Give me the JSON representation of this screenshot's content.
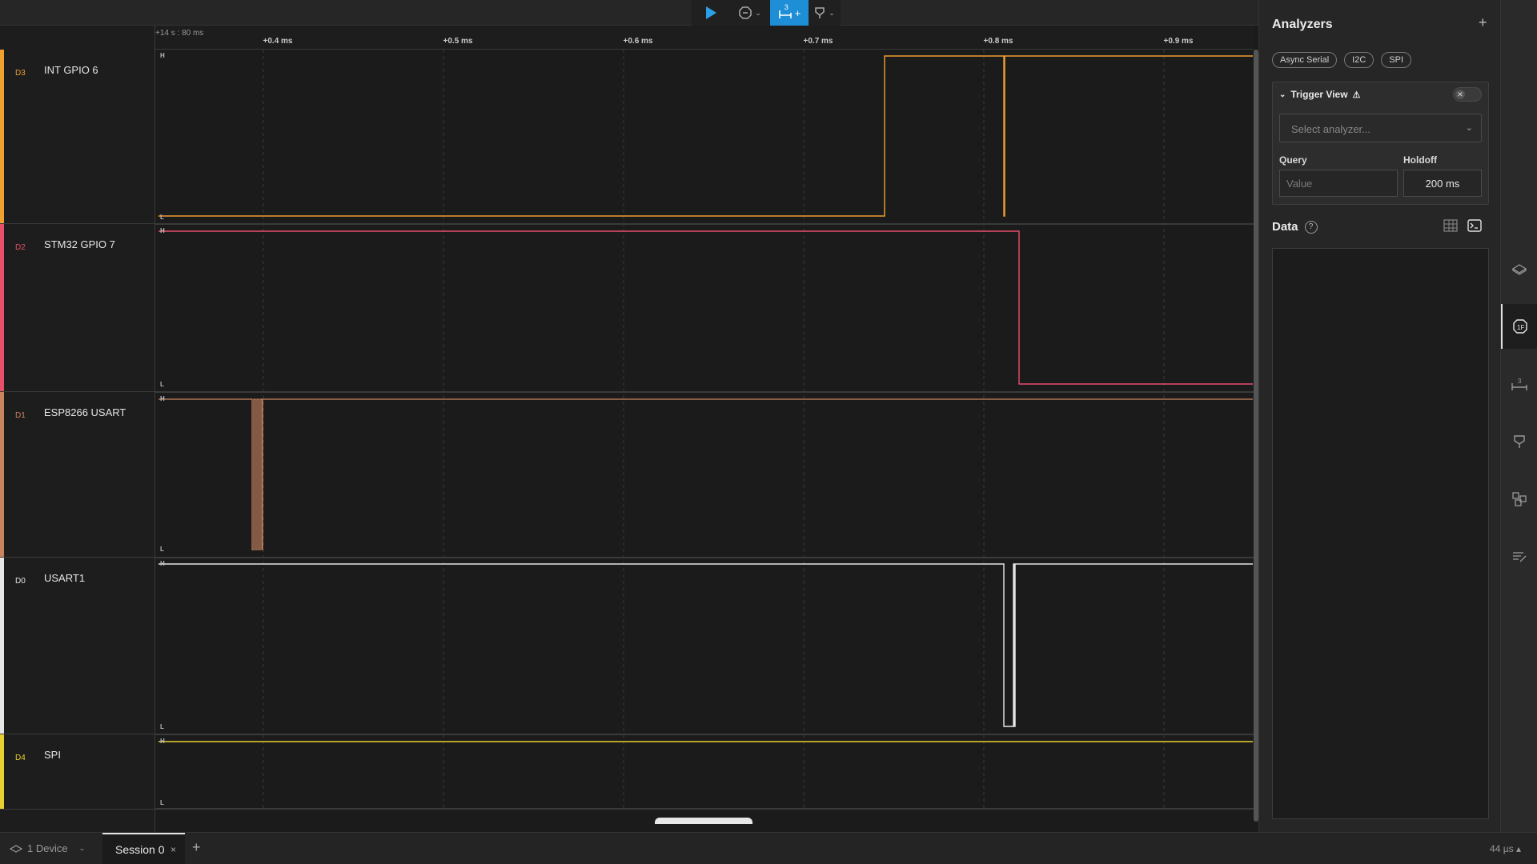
{
  "toolbar": {
    "play_icon": "play-icon",
    "trigger_icon": "trigger-icon",
    "measure_badge": "3",
    "measure_plus": "+",
    "marker_icon": "marker-icon"
  },
  "ruler": {
    "origin": "+14 s : 80 ms",
    "ticks": [
      "+0.4 ms",
      "+0.5 ms",
      "+0.6 ms",
      "+0.7 ms",
      "+0.8 ms",
      "+0.9 ms"
    ]
  },
  "channels": [
    {
      "id": "D3",
      "name": "INT GPIO 6",
      "color": "#f0a030"
    },
    {
      "id": "D2",
      "name": "STM32 GPIO 7",
      "color": "#e8506a"
    },
    {
      "id": "D1",
      "name": "ESP8266 USART",
      "color": "#c98560"
    },
    {
      "id": "D0",
      "name": "USART1",
      "color": "#e6e6e6"
    },
    {
      "id": "D4",
      "name": "SPI",
      "color": "#e8d030"
    }
  ],
  "levels": {
    "high": "H",
    "low": "L"
  },
  "panel": {
    "title": "Analyzers",
    "add": "+",
    "chips": [
      "Async Serial",
      "I2C",
      "SPI"
    ],
    "trigger": {
      "title": "Trigger View",
      "warning": "⚠",
      "toggle_x": "✕",
      "select_placeholder": "Select analyzer...",
      "query_label": "Query",
      "query_placeholder": "Value",
      "holdoff_label": "Holdoff",
      "holdoff_value": "200 ms"
    },
    "data": {
      "title": "Data",
      "help": "?"
    }
  },
  "bottombar": {
    "device": "1 Device",
    "session": "Session 0",
    "close": "×",
    "add": "+",
    "zoom": "44 µs ▴"
  },
  "accent": "#1e8fd6"
}
